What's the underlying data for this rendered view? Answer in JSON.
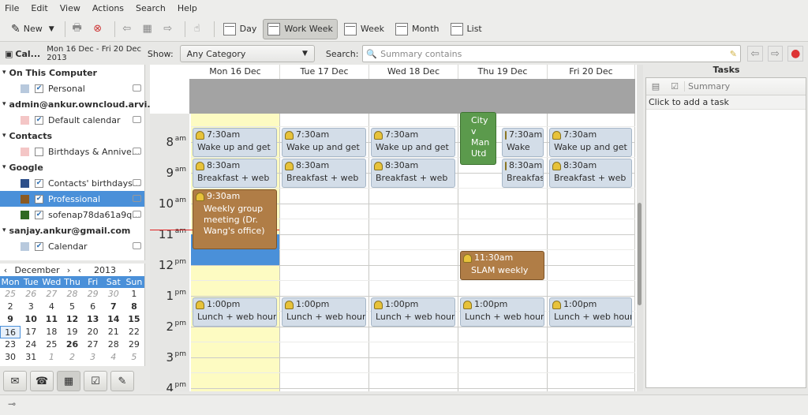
{
  "menu": [
    "File",
    "Edit",
    "View",
    "Actions",
    "Search",
    "Help"
  ],
  "toolbar": {
    "new_label": "New",
    "views": [
      {
        "label": "Day",
        "active": false
      },
      {
        "label": "Work Week",
        "active": true
      },
      {
        "label": "Week",
        "active": false
      },
      {
        "label": "Month",
        "active": false
      },
      {
        "label": "List",
        "active": false
      }
    ]
  },
  "header": {
    "cal_label": "Cal...",
    "date_range": "Mon 16 Dec - Fri 20 Dec 2013"
  },
  "filter": {
    "show_label": "Show:",
    "category": "Any Category",
    "search_label": "Search:",
    "search_placeholder": "Summary contains"
  },
  "sidebar": {
    "groups": [
      {
        "name": "On This Computer",
        "items": [
          {
            "label": "Personal",
            "color": "#b8c9dd",
            "checked": true,
            "linked": true
          }
        ]
      },
      {
        "name": "admin@ankur.owncloud.arvi...",
        "items": [
          {
            "label": "Default calendar",
            "color": "#f4c6c6",
            "checked": true,
            "linked": true
          }
        ]
      },
      {
        "name": "Contacts",
        "items": [
          {
            "label": "Birthdays & Annive...",
            "color": "#f4c6c6",
            "checked": false,
            "linked": true
          }
        ]
      },
      {
        "name": "Google",
        "items": [
          {
            "label": "Contacts' birthdays...",
            "color": "#2d4f8a",
            "checked": true,
            "linked": true
          },
          {
            "label": "Professional",
            "color": "#8a5a23",
            "checked": true,
            "linked": true,
            "selected": true
          },
          {
            "label": "sofenap78da61a9q...",
            "color": "#2f6a23",
            "checked": true,
            "linked": true
          }
        ]
      },
      {
        "name": "sanjay.ankur@gmail.com",
        "items": [
          {
            "label": "Calendar",
            "color": "#b8c9dd",
            "checked": true,
            "linked": true
          }
        ]
      }
    ]
  },
  "minical": {
    "month": "December",
    "year": "2013",
    "dows": [
      "Mon",
      "Tue",
      "Wed",
      "Thu",
      "Fri",
      "Sat",
      "Sun"
    ],
    "weeks": [
      [
        "25",
        "26",
        "27",
        "28",
        "29",
        "30",
        "1"
      ],
      [
        "2",
        "3",
        "4",
        "5",
        "6",
        "7",
        "8"
      ],
      [
        "9",
        "10",
        "11",
        "12",
        "13",
        "14",
        "15"
      ],
      [
        "16",
        "17",
        "18",
        "19",
        "20",
        "21",
        "22"
      ],
      [
        "23",
        "24",
        "25",
        "26",
        "27",
        "28",
        "29"
      ],
      [
        "30",
        "31",
        "1",
        "2",
        "3",
        "4",
        "5"
      ]
    ]
  },
  "days": [
    "Mon 16 Dec",
    "Tue 17 Dec",
    "Wed 18 Dec",
    "Thu 19 Dec",
    "Fri 20 Dec"
  ],
  "hours": [
    {
      "h": "8",
      "ap": "am"
    },
    {
      "h": "9",
      "ap": "am"
    },
    {
      "h": "10",
      "ap": "am"
    },
    {
      "h": "11",
      "ap": "am"
    },
    {
      "h": "12",
      "ap": "pm"
    },
    {
      "h": "1",
      "ap": "pm"
    },
    {
      "h": "2",
      "ap": "pm"
    },
    {
      "h": "3",
      "ap": "pm"
    },
    {
      "h": "4",
      "ap": "pm"
    }
  ],
  "events": [
    {
      "day": 0,
      "time": "7:30am",
      "name": "Wake up and get",
      "start": 7.5,
      "end": 8.5
    },
    {
      "day": 0,
      "time": "8:30am",
      "name": "Breakfast + web",
      "start": 8.5,
      "end": 9.5
    },
    {
      "day": 0,
      "time": "9:30am",
      "name": "Weekly group meeting (Dr. Wang's office)",
      "start": 9.5,
      "end": 11.5,
      "style": "brown"
    },
    {
      "day": 1,
      "time": "7:30am",
      "name": "Wake up and get",
      "start": 7.5,
      "end": 8.5
    },
    {
      "day": 1,
      "time": "8:30am",
      "name": "Breakfast + web",
      "start": 8.5,
      "end": 9.5
    },
    {
      "day": 2,
      "time": "7:30am",
      "name": "Wake up and get",
      "start": 7.5,
      "end": 8.5
    },
    {
      "day": 2,
      "time": "8:30am",
      "name": "Breakfast + web",
      "start": 8.5,
      "end": 9.5
    },
    {
      "day": 3,
      "time": "",
      "name": "City v Man Utd",
      "start": 7.0,
      "end": 8.8,
      "style": "green",
      "narrow": true
    },
    {
      "day": 3,
      "time": "7:30am",
      "name": "Wake",
      "start": 7.5,
      "end": 8.5,
      "half": true
    },
    {
      "day": 3,
      "time": "8:30am",
      "name": "Breakfast",
      "start": 8.5,
      "end": 9.5,
      "half": true
    },
    {
      "day": 3,
      "time": "11:30am",
      "name": "SLAM weekly",
      "start": 11.5,
      "end": 12.5,
      "style": "brown"
    },
    {
      "day": 4,
      "time": "7:30am",
      "name": "Wake up and get",
      "start": 7.5,
      "end": 8.5
    },
    {
      "day": 4,
      "time": "8:30am",
      "name": "Breakfast + web",
      "start": 8.5,
      "end": 9.5
    },
    {
      "day": 0,
      "time": "1:00pm",
      "name": "Lunch + web hour",
      "start": 13,
      "end": 14
    },
    {
      "day": 1,
      "time": "1:00pm",
      "name": "Lunch + web hour",
      "start": 13,
      "end": 14
    },
    {
      "day": 2,
      "time": "1:00pm",
      "name": "Lunch + web hour",
      "start": 13,
      "end": 14
    },
    {
      "day": 3,
      "time": "1:00pm",
      "name": "Lunch + web hour",
      "start": 13,
      "end": 14
    },
    {
      "day": 4,
      "time": "1:00pm",
      "name": "Lunch + web hour",
      "start": 13,
      "end": 14
    }
  ],
  "tasks": {
    "title": "Tasks",
    "summary_col": "Summary",
    "add_hint": "Click to add a task"
  }
}
